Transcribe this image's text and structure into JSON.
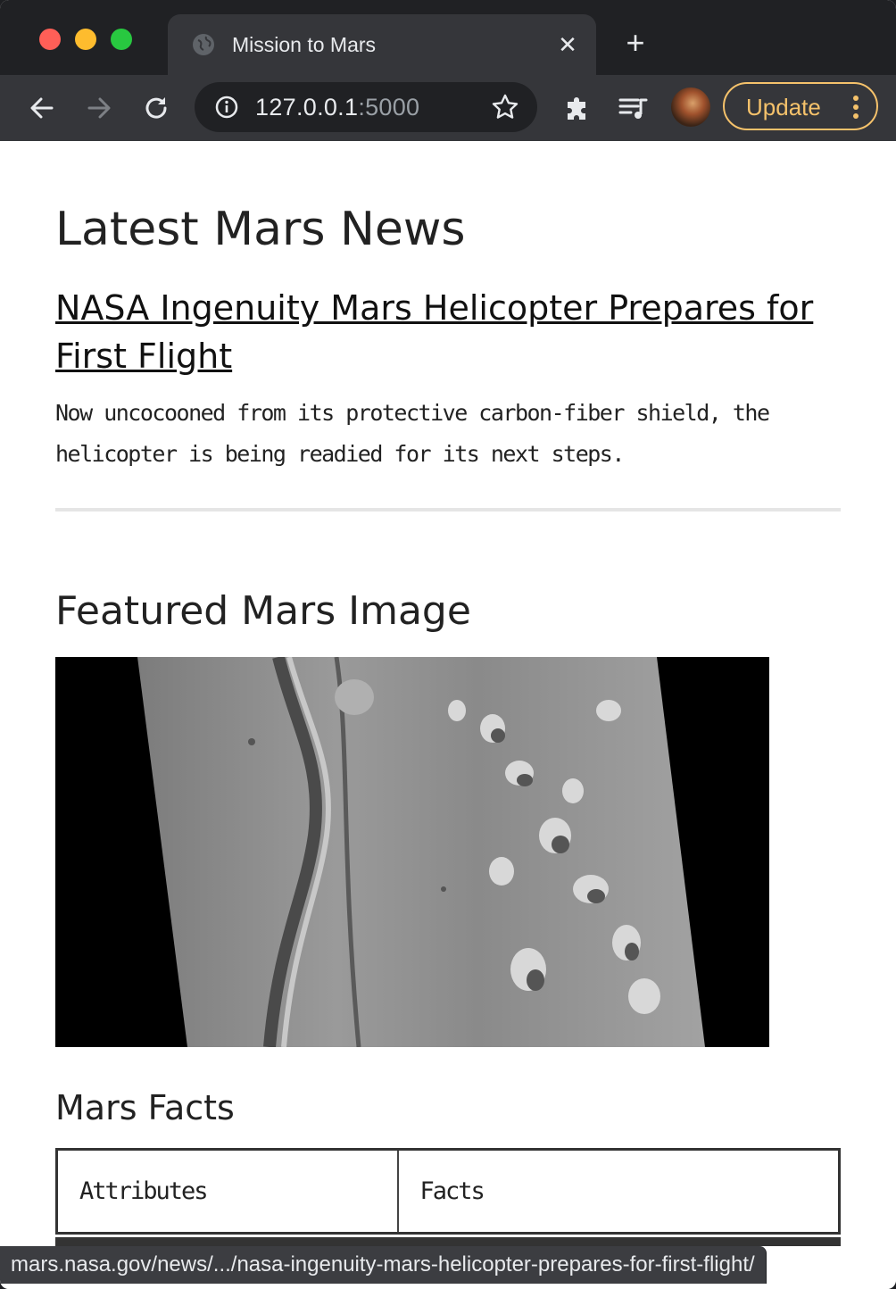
{
  "browser": {
    "tab_title": "Mission to Mars",
    "url_host": "127.0.0.1",
    "url_port": ":5000",
    "update_label": "Update",
    "status_url": "mars.nasa.gov/news/.../nasa-ingenuity-mars-helicopter-prepares-for-first-flight/",
    "icons": [
      "globe-icon",
      "close-icon",
      "plus-icon",
      "back-arrow-icon",
      "forward-arrow-icon",
      "reload-icon",
      "info-icon",
      "star-icon",
      "puzzle-icon",
      "media-queue-icon",
      "avatar",
      "kebab-menu-icon"
    ],
    "accent_color": "#f5c26b"
  },
  "page": {
    "news_heading": "Latest Mars News",
    "news_title": "NASA Ingenuity Mars Helicopter Prepares for First Flight",
    "news_teaser": "Now uncocooned from its protective carbon-fiber shield, the helicopter is being readied for its next steps.",
    "image_heading": "Featured Mars Image",
    "facts_heading": "Mars Facts",
    "facts_table": {
      "headers": [
        "Attributes",
        "Facts"
      ]
    }
  }
}
